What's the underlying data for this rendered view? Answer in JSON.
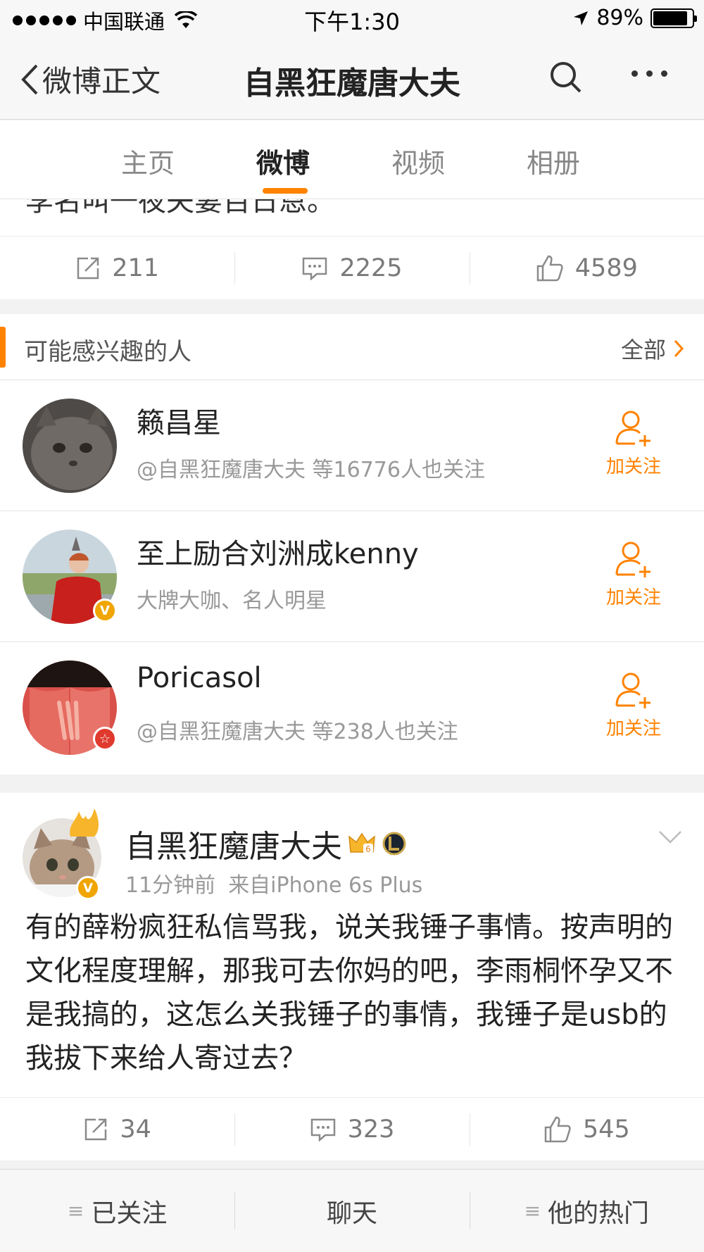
{
  "status_bar": {
    "carrier": "中国联通",
    "time": "下午1:30",
    "battery": "89%",
    "battery_level": 0.89
  },
  "nav": {
    "back_label": "微博正文",
    "title": "自黑狂魔唐大夫"
  },
  "tabs": [
    {
      "label": "主页"
    },
    {
      "label": "微博",
      "active": true
    },
    {
      "label": "视频"
    },
    {
      "label": "相册"
    }
  ],
  "prev_post": {
    "cut_text": "李名叫一夜夫妻百日恩。",
    "repost_count": "211",
    "comment_count": "2225",
    "like_count": "4589"
  },
  "recommend": {
    "title": "可能感兴趣的人",
    "all_label": "全部",
    "follow_label": "加关注",
    "people": [
      {
        "name": "籁昌星",
        "desc": "@自黑狂魔唐大夫 等16776人也关注",
        "badge": ""
      },
      {
        "name": "至上励合刘洲成kenny",
        "desc": "大牌大咖、名人明星",
        "badge": "V"
      },
      {
        "name": "Poricasol",
        "desc": "@自黑狂魔唐大夫 等238人也关注",
        "badge": "☆"
      }
    ]
  },
  "post": {
    "author": "自黑狂魔唐大夫",
    "level_badge": "6",
    "time": "11分钟前",
    "source": "来自iPhone 6s Plus",
    "text": "有的薛粉疯狂私信骂我，说关我锤子事情。按声明的文化程度理解，那我可去你妈的吧，李雨桐怀孕又不是我搞的，这怎么关我锤子的事情，我锤子是usb的我拔下来给人寄过去？",
    "repost_count": "34",
    "comment_count": "323",
    "like_count": "545"
  },
  "bottom_bar": {
    "followed": "已关注",
    "chat": "聊天",
    "hot": "他的热门",
    "menu_glyph": "≡"
  },
  "colors": {
    "accent": "#ff8200",
    "verified": "#f0a500",
    "gray_text": "#999999"
  }
}
